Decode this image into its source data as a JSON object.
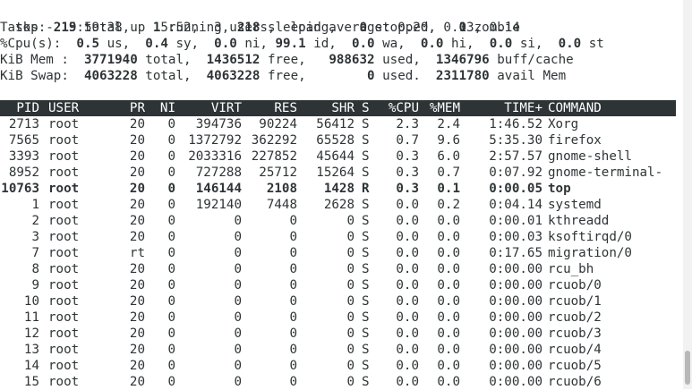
{
  "summary": {
    "line1": {
      "prefix": "top - 15:59:38 up  5:52,  3 users,  load average: 0.20, 0.13, 0.14"
    },
    "line2": {
      "label": "Tasks: ",
      "total": "219",
      "total_label": " total,   ",
      "running": "1",
      "running_label": " running, ",
      "sleeping": "218",
      "sleeping_label": " sleeping,   ",
      "stopped": "0",
      "stopped_label": " stopped,   ",
      "zombie": "0",
      "zombie_label": " zombie"
    },
    "line3": {
      "label": "%Cpu(s):  ",
      "us": "0.5",
      "us_label": " us,  ",
      "sy": "0.4",
      "sy_label": " sy,  ",
      "ni": "0.0",
      "ni_label": " ni, ",
      "id": "99.1",
      "id_label": " id,  ",
      "wa": "0.0",
      "wa_label": " wa,  ",
      "hi": "0.0",
      "hi_label": " hi,  ",
      "si": "0.0",
      "si_label": " si,  ",
      "st": "0.0",
      "st_label": " st"
    },
    "line4": {
      "label": "KiB Mem :  ",
      "total": "3771940",
      "total_label": " total,  ",
      "free": "1436512",
      "free_label": " free,   ",
      "used": "988632",
      "used_label": " used,  ",
      "buff": "1346796",
      "buff_label": " buff/cache"
    },
    "line5": {
      "label": "KiB Swap:  ",
      "total": "4063228",
      "total_label": " total,  ",
      "free": "4063228",
      "free_label": " free,        ",
      "used": "0",
      "used_label": " used.  ",
      "avail": "2311780",
      "avail_label": " avail Mem"
    }
  },
  "columns": [
    "PID",
    "USER",
    "PR",
    "NI",
    "VIRT",
    "RES",
    "SHR",
    "S",
    "%CPU",
    "%MEM",
    "TIME+",
    "COMMAND"
  ],
  "processes": [
    {
      "pid": "2713",
      "user": "root",
      "pr": "20",
      "ni": "0",
      "virt": "394736",
      "res": "90224",
      "shr": "56412",
      "s": "S",
      "cpu": "2.3",
      "mem": "2.4",
      "time": "1:46.52",
      "command": "Xorg",
      "bold": false
    },
    {
      "pid": "7565",
      "user": "root",
      "pr": "20",
      "ni": "0",
      "virt": "1372792",
      "res": "362292",
      "shr": "65528",
      "s": "S",
      "cpu": "0.7",
      "mem": "9.6",
      "time": "5:35.30",
      "command": "firefox",
      "bold": false
    },
    {
      "pid": "3393",
      "user": "root",
      "pr": "20",
      "ni": "0",
      "virt": "2033316",
      "res": "227852",
      "shr": "45644",
      "s": "S",
      "cpu": "0.3",
      "mem": "6.0",
      "time": "2:57.57",
      "command": "gnome-shell",
      "bold": false
    },
    {
      "pid": "8952",
      "user": "root",
      "pr": "20",
      "ni": "0",
      "virt": "727288",
      "res": "25712",
      "shr": "15264",
      "s": "S",
      "cpu": "0.3",
      "mem": "0.7",
      "time": "0:07.92",
      "command": "gnome-terminal-",
      "bold": false
    },
    {
      "pid": "10763",
      "user": "root",
      "pr": "20",
      "ni": "0",
      "virt": "146144",
      "res": "2108",
      "shr": "1428",
      "s": "R",
      "cpu": "0.3",
      "mem": "0.1",
      "time": "0:00.05",
      "command": "top",
      "bold": true
    },
    {
      "pid": "1",
      "user": "root",
      "pr": "20",
      "ni": "0",
      "virt": "192140",
      "res": "7448",
      "shr": "2628",
      "s": "S",
      "cpu": "0.0",
      "mem": "0.2",
      "time": "0:04.14",
      "command": "systemd",
      "bold": false
    },
    {
      "pid": "2",
      "user": "root",
      "pr": "20",
      "ni": "0",
      "virt": "0",
      "res": "0",
      "shr": "0",
      "s": "S",
      "cpu": "0.0",
      "mem": "0.0",
      "time": "0:00.01",
      "command": "kthreadd",
      "bold": false
    },
    {
      "pid": "3",
      "user": "root",
      "pr": "20",
      "ni": "0",
      "virt": "0",
      "res": "0",
      "shr": "0",
      "s": "S",
      "cpu": "0.0",
      "mem": "0.0",
      "time": "0:00.03",
      "command": "ksoftirqd/0",
      "bold": false
    },
    {
      "pid": "7",
      "user": "root",
      "pr": "rt",
      "ni": "0",
      "virt": "0",
      "res": "0",
      "shr": "0",
      "s": "S",
      "cpu": "0.0",
      "mem": "0.0",
      "time": "0:17.65",
      "command": "migration/0",
      "bold": false
    },
    {
      "pid": "8",
      "user": "root",
      "pr": "20",
      "ni": "0",
      "virt": "0",
      "res": "0",
      "shr": "0",
      "s": "S",
      "cpu": "0.0",
      "mem": "0.0",
      "time": "0:00.00",
      "command": "rcu_bh",
      "bold": false
    },
    {
      "pid": "9",
      "user": "root",
      "pr": "20",
      "ni": "0",
      "virt": "0",
      "res": "0",
      "shr": "0",
      "s": "S",
      "cpu": "0.0",
      "mem": "0.0",
      "time": "0:00.00",
      "command": "rcuob/0",
      "bold": false
    },
    {
      "pid": "10",
      "user": "root",
      "pr": "20",
      "ni": "0",
      "virt": "0",
      "res": "0",
      "shr": "0",
      "s": "S",
      "cpu": "0.0",
      "mem": "0.0",
      "time": "0:00.00",
      "command": "rcuob/1",
      "bold": false
    },
    {
      "pid": "11",
      "user": "root",
      "pr": "20",
      "ni": "0",
      "virt": "0",
      "res": "0",
      "shr": "0",
      "s": "S",
      "cpu": "0.0",
      "mem": "0.0",
      "time": "0:00.00",
      "command": "rcuob/2",
      "bold": false
    },
    {
      "pid": "12",
      "user": "root",
      "pr": "20",
      "ni": "0",
      "virt": "0",
      "res": "0",
      "shr": "0",
      "s": "S",
      "cpu": "0.0",
      "mem": "0.0",
      "time": "0:00.00",
      "command": "rcuob/3",
      "bold": false
    },
    {
      "pid": "13",
      "user": "root",
      "pr": "20",
      "ni": "0",
      "virt": "0",
      "res": "0",
      "shr": "0",
      "s": "S",
      "cpu": "0.0",
      "mem": "0.0",
      "time": "0:00.00",
      "command": "rcuob/4",
      "bold": false
    },
    {
      "pid": "14",
      "user": "root",
      "pr": "20",
      "ni": "0",
      "virt": "0",
      "res": "0",
      "shr": "0",
      "s": "S",
      "cpu": "0.0",
      "mem": "0.0",
      "time": "0:00.00",
      "command": "rcuob/5",
      "bold": false
    },
    {
      "pid": "15",
      "user": "root",
      "pr": "20",
      "ni": "0",
      "virt": "0",
      "res": "0",
      "shr": "0",
      "s": "S",
      "cpu": "0.0",
      "mem": "0.0",
      "time": "0:00.00",
      "command": "rcuob/6",
      "bold": false
    }
  ],
  "colors": {
    "text": "#2e3436",
    "header_bg": "#2e3436",
    "header_fg": "#ffffff",
    "background": "#ffffff"
  }
}
